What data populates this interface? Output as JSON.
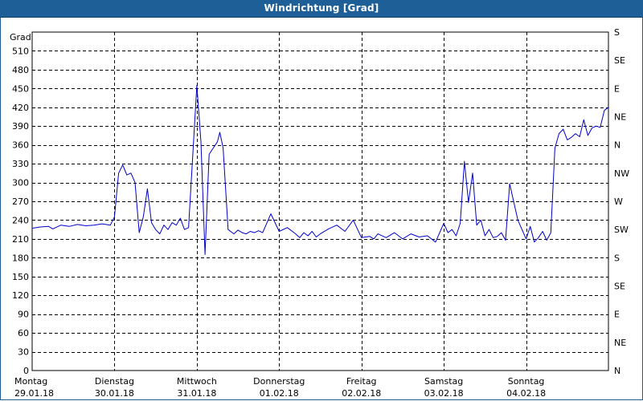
{
  "window": {
    "title": "Windrichtung [Grad]"
  },
  "chart_data": {
    "type": "line",
    "title": "Windrichtung [Grad]",
    "ylabel": "Grad",
    "ylim": [
      0,
      540
    ],
    "y_ticks": [
      0,
      30,
      60,
      90,
      120,
      150,
      180,
      210,
      240,
      270,
      300,
      330,
      360,
      390,
      420,
      450,
      480,
      510
    ],
    "right_axis_labels": [
      "N",
      "NE",
      "E",
      "SE",
      "S",
      "SW",
      "W",
      "NW",
      "N",
      "NE",
      "E",
      "SE",
      "S"
    ],
    "x_labels": [
      {
        "day": "Montag",
        "date": "29.01.18"
      },
      {
        "day": "Dienstag",
        "date": "30.01.18"
      },
      {
        "day": "Mittwoch",
        "date": "31.01.18"
      },
      {
        "day": "Donnerstag",
        "date": "01.02.18"
      },
      {
        "day": "Freitag",
        "date": "02.02.18"
      },
      {
        "day": "Samstag",
        "date": "03.02.18"
      },
      {
        "day": "Sonntag",
        "date": "04.02.18"
      }
    ],
    "xlim_days": [
      0,
      7
    ],
    "grid": true,
    "line_color": "#0000cc",
    "series": [
      {
        "x": [
          0.0,
          0.1,
          0.2,
          0.25,
          0.35,
          0.45,
          0.55,
          0.65,
          0.75,
          0.85,
          0.95,
          1.0,
          1.05,
          1.1,
          1.15,
          1.2,
          1.25,
          1.3,
          1.35,
          1.4,
          1.45,
          1.5,
          1.55,
          1.6,
          1.65,
          1.7,
          1.75,
          1.8,
          1.85,
          1.9,
          2.0,
          2.05,
          2.1,
          2.15,
          2.2,
          2.25,
          2.28,
          2.32,
          2.38,
          2.45,
          2.5,
          2.55,
          2.6,
          2.65,
          2.7,
          2.75,
          2.8,
          2.9,
          3.0,
          3.1,
          3.2,
          3.25,
          3.3,
          3.35,
          3.4,
          3.45,
          3.5,
          3.6,
          3.7,
          3.8,
          3.9,
          4.0,
          4.1,
          4.15,
          4.2,
          4.3,
          4.4,
          4.5,
          4.6,
          4.7,
          4.8,
          4.9,
          5.0,
          5.05,
          5.1,
          5.15,
          5.2,
          5.25,
          5.3,
          5.35,
          5.4,
          5.45,
          5.5,
          5.55,
          5.6,
          5.65,
          5.7,
          5.75,
          5.8,
          5.9,
          6.0,
          6.05,
          6.1,
          6.15,
          6.2,
          6.25,
          6.3,
          6.35,
          6.4,
          6.45,
          6.5,
          6.55,
          6.6,
          6.65,
          6.7,
          6.75,
          6.8,
          6.85,
          6.9,
          6.95,
          7.0
        ],
        "y": [
          227,
          229,
          230,
          226,
          232,
          230,
          233,
          231,
          232,
          234,
          232,
          245,
          315,
          328,
          312,
          315,
          300,
          220,
          245,
          290,
          236,
          225,
          218,
          232,
          225,
          236,
          232,
          243,
          225,
          228,
          455,
          365,
          185,
          345,
          355,
          365,
          380,
          355,
          225,
          218,
          224,
          220,
          218,
          222,
          220,
          223,
          220,
          250,
          222,
          228,
          218,
          212,
          220,
          215,
          222,
          213,
          218,
          226,
          232,
          222,
          240,
          212,
          214,
          210,
          218,
          212,
          220,
          210,
          218,
          213,
          215,
          205,
          235,
          220,
          225,
          215,
          235,
          334,
          268,
          315,
          232,
          240,
          215,
          225,
          212,
          214,
          220,
          208,
          298,
          240,
          210,
          230,
          205,
          212,
          222,
          208,
          220,
          355,
          378,
          385,
          368,
          372,
          378,
          373,
          400,
          375,
          387,
          390,
          388,
          415,
          420
        ]
      }
    ]
  }
}
